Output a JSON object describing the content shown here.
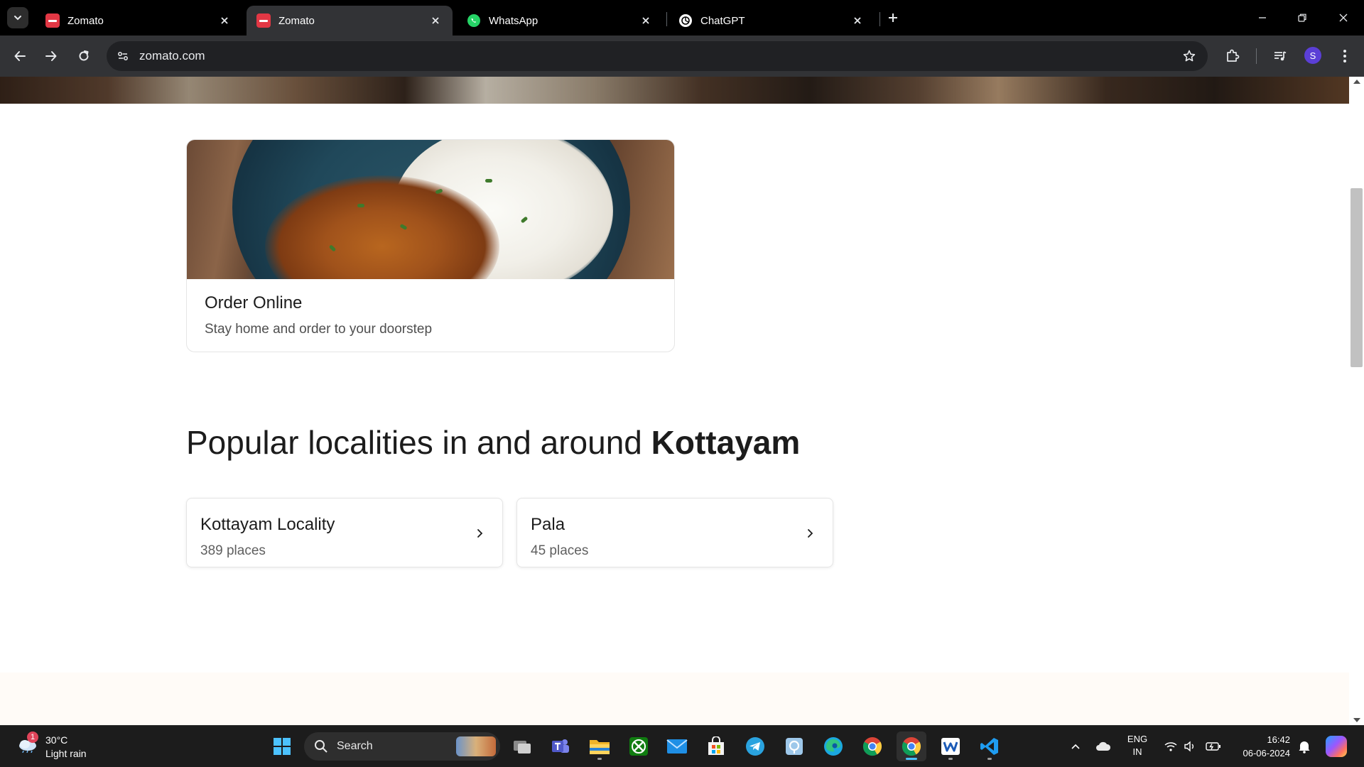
{
  "browser": {
    "tabs": [
      {
        "title": "Zomato",
        "favicon": "zomato-icon",
        "active": false
      },
      {
        "title": "Zomato",
        "favicon": "zomato-icon",
        "active": true
      },
      {
        "title": "WhatsApp",
        "favicon": "whatsapp-icon",
        "active": false
      },
      {
        "title": "ChatGPT",
        "favicon": "chatgpt-icon",
        "active": false
      }
    ],
    "url": "zomato.com",
    "profile_initial": "S"
  },
  "page": {
    "order_card": {
      "title": "Order Online",
      "subtitle": "Stay home and order to your doorstep"
    },
    "localities_heading": {
      "prefix": "Popular localities in and around ",
      "city": "Kottayam"
    },
    "localities": [
      {
        "name": "Kottayam Locality",
        "count": "389 places"
      },
      {
        "name": "Pala",
        "count": "45 places"
      }
    ]
  },
  "taskbar": {
    "weather": {
      "temp": "30°C",
      "desc": "Light rain",
      "badge": "1"
    },
    "search_placeholder": "Search",
    "language": {
      "line1": "ENG",
      "line2": "IN"
    },
    "clock": {
      "time": "16:42",
      "date": "06-06-2024"
    }
  },
  "colors": {
    "zomato_red": "#e23744",
    "tab_active": "#323336",
    "tabstrip": "#000000",
    "taskbar": "#1c1c1c",
    "accent": "#4cc2ff"
  }
}
